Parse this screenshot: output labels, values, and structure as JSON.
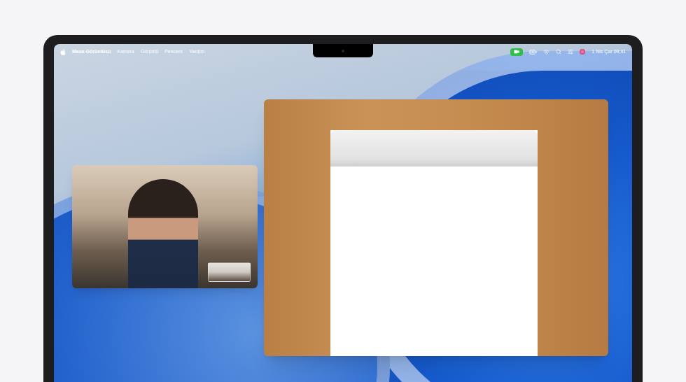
{
  "menu_bar": {
    "app": "Masa Görüntüsü",
    "items": [
      "Kamera",
      "Görüntü",
      "Pencere",
      "Yardım"
    ],
    "camera_active": true,
    "clock": "1 Nis Çar 09:41"
  }
}
